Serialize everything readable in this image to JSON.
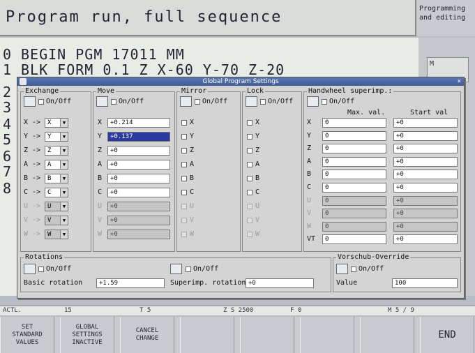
{
  "header": {
    "title": "Program run, full sequence",
    "mode2": "Programming and editing"
  },
  "program": {
    "lines": [
      {
        "n": "0",
        "text": "BEGIN PGM 17011 MM"
      },
      {
        "n": "1",
        "text": "BLK FORM 0.1 Z  X-60  Y-70  Z-20"
      },
      {
        "n": "2",
        "text": ""
      },
      {
        "n": "3",
        "text": ""
      },
      {
        "n": "4",
        "text": ""
      },
      {
        "n": "5",
        "text": ""
      },
      {
        "n": "6",
        "text": ""
      },
      {
        "n": "7",
        "text": ""
      },
      {
        "n": "8",
        "text": ""
      }
    ]
  },
  "right_panel": {
    "m_label": "M"
  },
  "dialog": {
    "title": "Global Program Settings",
    "close": "×",
    "exchange": {
      "label": "Exchange",
      "onoff": "On/Off",
      "rows": [
        {
          "from": "X",
          "to": "X"
        },
        {
          "from": "Y",
          "to": "Y"
        },
        {
          "from": "Z",
          "to": "Z"
        },
        {
          "from": "A",
          "to": "A"
        },
        {
          "from": "B",
          "to": "B"
        },
        {
          "from": "C",
          "to": "C"
        },
        {
          "from": "U",
          "to": "U"
        },
        {
          "from": "V",
          "to": "V"
        },
        {
          "from": "W",
          "to": "W"
        }
      ]
    },
    "move": {
      "label": "Move",
      "onoff": "On/Off",
      "rows": [
        {
          "axis": "X",
          "value": "+0.214"
        },
        {
          "axis": "Y",
          "value": "+0.137"
        },
        {
          "axis": "Z",
          "value": "+0"
        },
        {
          "axis": "A",
          "value": "+0"
        },
        {
          "axis": "B",
          "value": "+0"
        },
        {
          "axis": "C",
          "value": "+0"
        },
        {
          "axis": "U",
          "value": "+0"
        },
        {
          "axis": "V",
          "value": "+0"
        },
        {
          "axis": "W",
          "value": "+0"
        }
      ]
    },
    "mirror": {
      "label": "Mirror",
      "onoff": "On/Off",
      "axes": [
        "X",
        "Y",
        "Z",
        "A",
        "B",
        "C",
        "U",
        "V",
        "W"
      ]
    },
    "lock": {
      "label": "Lock",
      "onoff": "On/Off",
      "axes": [
        "X",
        "Y",
        "Z",
        "A",
        "B",
        "C",
        "U",
        "V",
        "W"
      ]
    },
    "handwheel": {
      "label": "Handwheel superimp.:",
      "onoff": "On/Off",
      "max_header": "Max. val.",
      "start_header": "Start val",
      "rows": [
        {
          "axis": "X",
          "max": "0",
          "start": "+0"
        },
        {
          "axis": "Y",
          "max": "0",
          "start": "+0"
        },
        {
          "axis": "Z",
          "max": "0",
          "start": "+0"
        },
        {
          "axis": "A",
          "max": "0",
          "start": "+0"
        },
        {
          "axis": "B",
          "max": "0",
          "start": "+0"
        },
        {
          "axis": "C",
          "max": "0",
          "start": "+0"
        },
        {
          "axis": "U",
          "max": "0",
          "start": "+0"
        },
        {
          "axis": "V",
          "max": "0",
          "start": "+0"
        },
        {
          "axis": "W",
          "max": "0",
          "start": "+0"
        },
        {
          "axis": "VT",
          "max": "0",
          "start": "+0"
        }
      ]
    },
    "rotations": {
      "label": "Rotations",
      "onoff": "On/Off",
      "onoff2": "On/Off",
      "basic_label": "Basic rotation",
      "basic_value": "+1.59",
      "superimp_label": "Superimp. rotation",
      "superimp_value": "+0"
    },
    "feed": {
      "label": "Vorschub-Override",
      "onoff": "On/Off",
      "value_label": "Value",
      "value": "100"
    }
  },
  "status": {
    "actl": "ACTL.",
    "feed": "15",
    "tool": "T 5",
    "spindle": "Z S 2500",
    "f": "F 0",
    "m": "M 5 / 9"
  },
  "softkeys": [
    {
      "label": "SET\nSTANDARD\nVALUES"
    },
    {
      "label": "GLOBAL\nSETTINGS\nINACTIVE"
    },
    {
      "label": "CANCEL\nCHANGE"
    },
    {
      "label": ""
    },
    {
      "label": ""
    },
    {
      "label": ""
    },
    {
      "label": ""
    },
    {
      "label": "END"
    }
  ]
}
